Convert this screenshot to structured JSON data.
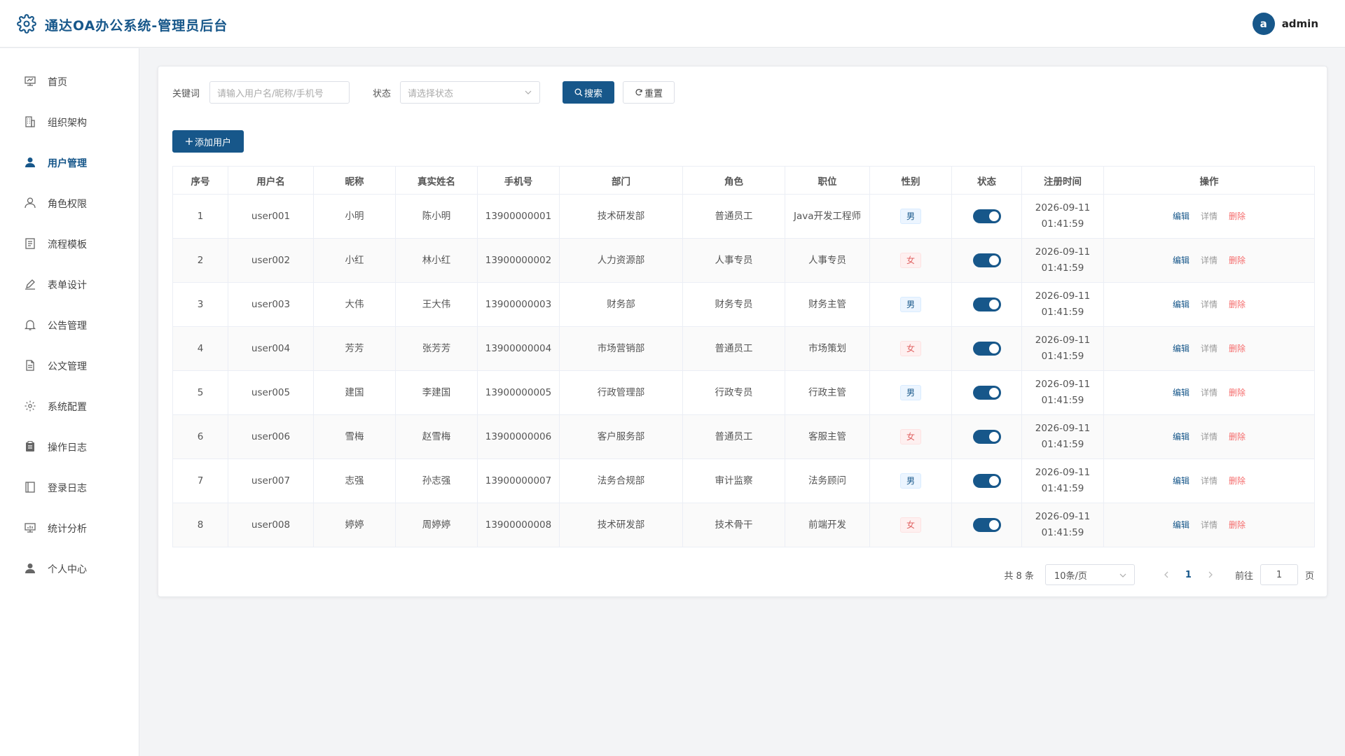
{
  "app": {
    "title": "通达OA办公系统-管理员后台"
  },
  "user": {
    "avatar_letter": "a",
    "name": "admin"
  },
  "sidebar": {
    "items": [
      {
        "label": "首页",
        "icon": "dashboard-icon",
        "active": false
      },
      {
        "label": "组织架构",
        "icon": "building-icon",
        "active": false
      },
      {
        "label": "用户管理",
        "icon": "user-filled-icon",
        "active": true
      },
      {
        "label": "角色权限",
        "icon": "user-outline-icon",
        "active": false
      },
      {
        "label": "流程模板",
        "icon": "document-icon",
        "active": false
      },
      {
        "label": "表单设计",
        "icon": "pen-icon",
        "active": false
      },
      {
        "label": "公告管理",
        "icon": "bell-icon",
        "active": false
      },
      {
        "label": "公文管理",
        "icon": "file-icon",
        "active": false
      },
      {
        "label": "系统配置",
        "icon": "gear-icon",
        "active": false
      },
      {
        "label": "操作日志",
        "icon": "clipboard-icon",
        "active": false
      },
      {
        "label": "登录日志",
        "icon": "notebook-icon",
        "active": false
      },
      {
        "label": "统计分析",
        "icon": "chart-icon",
        "active": false
      },
      {
        "label": "个人中心",
        "icon": "user-filled-icon",
        "active": false
      }
    ]
  },
  "filters": {
    "keyword_label": "关键词",
    "keyword_placeholder": "请输入用户名/昵称/手机号",
    "status_label": "状态",
    "status_placeholder": "请选择状态",
    "search_label": "搜索",
    "reset_label": "重置"
  },
  "toolbar": {
    "add_user_label": "添加用户"
  },
  "table": {
    "columns": [
      "序号",
      "用户名",
      "昵称",
      "真实姓名",
      "手机号",
      "部门",
      "角色",
      "职位",
      "性别",
      "状态",
      "注册时间",
      "操作"
    ],
    "actions": {
      "edit": "编辑",
      "detail": "详情",
      "delete": "删除"
    },
    "rows": [
      {
        "no": "1",
        "username": "user001",
        "nickname": "小明",
        "realname": "陈小明",
        "phone": "13900000001",
        "dept": "技术研发部",
        "role": "普通员工",
        "position": "Java开发工程师",
        "gender": "男",
        "enabled": true,
        "reg_date": "2026-09-11",
        "reg_time": "01:41:59"
      },
      {
        "no": "2",
        "username": "user002",
        "nickname": "小红",
        "realname": "林小红",
        "phone": "13900000002",
        "dept": "人力资源部",
        "role": "人事专员",
        "position": "人事专员",
        "gender": "女",
        "enabled": true,
        "reg_date": "2026-09-11",
        "reg_time": "01:41:59"
      },
      {
        "no": "3",
        "username": "user003",
        "nickname": "大伟",
        "realname": "王大伟",
        "phone": "13900000003",
        "dept": "财务部",
        "role": "财务专员",
        "position": "财务主管",
        "gender": "男",
        "enabled": true,
        "reg_date": "2026-09-11",
        "reg_time": "01:41:59"
      },
      {
        "no": "4",
        "username": "user004",
        "nickname": "芳芳",
        "realname": "张芳芳",
        "phone": "13900000004",
        "dept": "市场营销部",
        "role": "普通员工",
        "position": "市场策划",
        "gender": "女",
        "enabled": true,
        "reg_date": "2026-09-11",
        "reg_time": "01:41:59"
      },
      {
        "no": "5",
        "username": "user005",
        "nickname": "建国",
        "realname": "李建国",
        "phone": "13900000005",
        "dept": "行政管理部",
        "role": "行政专员",
        "position": "行政主管",
        "gender": "男",
        "enabled": true,
        "reg_date": "2026-09-11",
        "reg_time": "01:41:59"
      },
      {
        "no": "6",
        "username": "user006",
        "nickname": "雪梅",
        "realname": "赵雪梅",
        "phone": "13900000006",
        "dept": "客户服务部",
        "role": "普通员工",
        "position": "客服主管",
        "gender": "女",
        "enabled": true,
        "reg_date": "2026-09-11",
        "reg_time": "01:41:59"
      },
      {
        "no": "7",
        "username": "user007",
        "nickname": "志强",
        "realname": "孙志强",
        "phone": "13900000007",
        "dept": "法务合规部",
        "role": "审计监察",
        "position": "法务顾问",
        "gender": "男",
        "enabled": true,
        "reg_date": "2026-09-11",
        "reg_time": "01:41:59"
      },
      {
        "no": "8",
        "username": "user008",
        "nickname": "婷婷",
        "realname": "周婷婷",
        "phone": "13900000008",
        "dept": "技术研发部",
        "role": "技术骨干",
        "position": "前端开发",
        "gender": "女",
        "enabled": true,
        "reg_date": "2026-09-11",
        "reg_time": "01:41:59"
      }
    ]
  },
  "pagination": {
    "total_text": "共 8 条",
    "page_size": "10条/页",
    "current_page": "1",
    "goto_label": "前往",
    "goto_value": "1",
    "page_suffix": "页"
  },
  "colors": {
    "primary": "#17578a",
    "danger": "#f56c6c",
    "female_tag": "#e06363"
  }
}
